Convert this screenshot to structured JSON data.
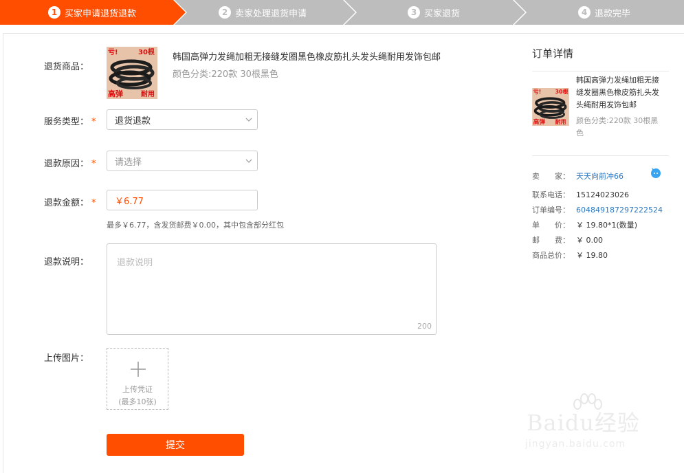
{
  "steps": [
    {
      "num": "1",
      "label": "买家申请退货退款",
      "active": true
    },
    {
      "num": "2",
      "label": "卖家处理退货申请",
      "active": false
    },
    {
      "num": "3",
      "label": "买家退货",
      "active": false
    },
    {
      "num": "4",
      "label": "退款完毕",
      "active": false
    }
  ],
  "form": {
    "product_label": "退货商品：",
    "product_title": "韩国高弹力发绳加粗无接缝发圈黑色橡皮筋扎头发头绳耐用发饰包邮",
    "product_sku": "颜色分类:220款 30根黑色",
    "thumb_texts": {
      "tl": "亏!",
      "tr": "30根",
      "bl": "高弹",
      "br": "耐用"
    },
    "service_label": "服务类型：",
    "service_value": "退货退款",
    "reason_label": "退款原因：",
    "reason_placeholder": "请选择",
    "amount_label": "退款金额：",
    "amount_value": "￥6.77",
    "amount_hint": "最多￥6.77，含发货邮费￥0.00，其中包含部分红包",
    "desc_label": "退款说明：",
    "desc_placeholder": "退款说明",
    "desc_counter": "200",
    "upload_label": "上传图片：",
    "upload_text1": "上传凭证",
    "upload_text2": "(最多10张)",
    "submit_label": "提交",
    "required_mark": "*"
  },
  "order": {
    "title": "订单详情",
    "product_title": "韩国高弹力发绳加粗无接缝发圈黑色橡皮筋扎头发头绳耐用发饰包邮",
    "product_sku": "颜色分类:220款 30根黑色",
    "seller_label": "卖　　家：",
    "seller_value": "天天向前冲66",
    "phone_label": "联系电话：",
    "phone_value": "15124023026",
    "order_no_label": "订单编号：",
    "order_no_value": "604849187297222524",
    "price_label": "单　　价：",
    "price_value": "￥ 19.80*1(数量)",
    "postage_label": "邮　　费：",
    "postage_value": "￥ 0.00",
    "total_label": "商品总价：",
    "total_value": "￥ 19.80"
  },
  "watermark": {
    "brand": "Baidu经验",
    "url": "jingyan.baidu.com"
  },
  "colors": {
    "accent": "#ff4e00",
    "step_inactive": "#bdbdbd",
    "link": "#2d78c0"
  },
  "icons": {
    "dropdown": "chevron-down-icon",
    "upload": "plus-icon",
    "chat": "wangwang-icon"
  }
}
